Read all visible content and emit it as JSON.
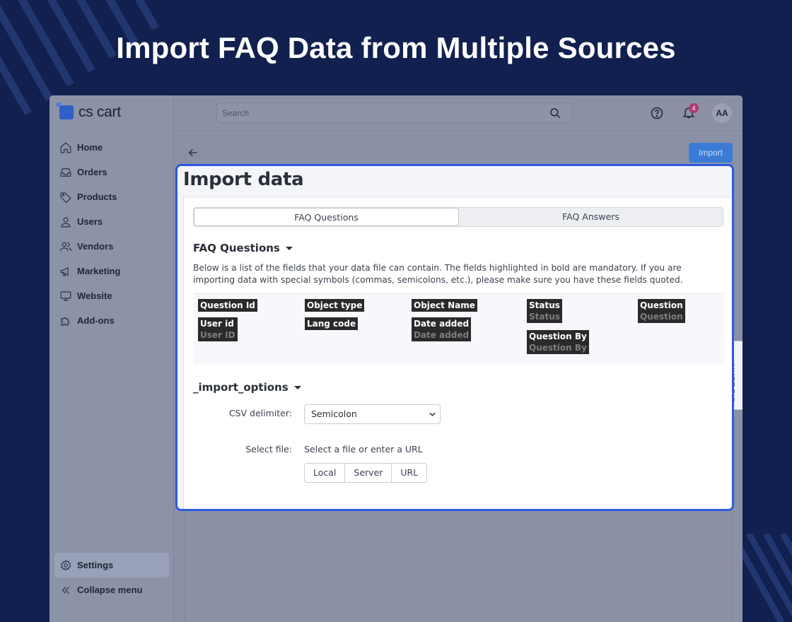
{
  "promo": {
    "title": "Import FAQ Data from Multiple Sources"
  },
  "app": {
    "logo_text": "cs cart",
    "search_placeholder": "Search",
    "notifications_count": "4",
    "avatar_initials": "AA",
    "import_button": "Import",
    "sidebar_toggle": "SIDEBAR"
  },
  "nav": {
    "items": [
      {
        "label": "Home",
        "icon": "home-icon"
      },
      {
        "label": "Orders",
        "icon": "inbox-icon"
      },
      {
        "label": "Products",
        "icon": "tag-icon"
      },
      {
        "label": "Users",
        "icon": "user-icon"
      },
      {
        "label": "Vendors",
        "icon": "users-icon"
      },
      {
        "label": "Marketing",
        "icon": "megaphone-icon"
      },
      {
        "label": "Website",
        "icon": "monitor-icon"
      },
      {
        "label": "Add-ons",
        "icon": "puzzle-icon"
      }
    ],
    "bottom": [
      {
        "label": "Settings",
        "icon": "gear-icon"
      },
      {
        "label": "Collapse menu",
        "icon": "double-chevron-left-icon"
      }
    ]
  },
  "panel": {
    "title": "Import data",
    "tabs": [
      {
        "label": "FAQ Questions"
      },
      {
        "label": "FAQ Answers"
      }
    ],
    "section_fields": "FAQ Questions",
    "description": "Below is a list of the fields that your data file can contain. The fields highlighted in bold are mandatory. If you are importing data with special symbols (commas, semicolons, etc.), please make sure you have these fields quoted.",
    "fields": [
      {
        "name": "Question Id",
        "sub": ""
      },
      {
        "name": "Object type",
        "sub": ""
      },
      {
        "name": "Object Name",
        "sub": ""
      },
      {
        "name": "Status",
        "sub": "Status"
      },
      {
        "name": "Question",
        "sub": "Question"
      },
      {
        "name": "User id",
        "sub": "User ID"
      },
      {
        "name": "Lang code",
        "sub": ""
      },
      {
        "name": "Date added",
        "sub": "Date added"
      },
      {
        "name": "Question By",
        "sub": "Question By"
      }
    ],
    "section_options": "_import_options",
    "csv_label": "CSV delimiter:",
    "csv_value": "Semicolon",
    "file_label": "Select file:",
    "file_hint": "Select a file or enter a URL",
    "file_buttons": [
      {
        "label": "Local"
      },
      {
        "label": "Server"
      },
      {
        "label": "URL"
      }
    ]
  },
  "colors": {
    "accent": "#2c5ae0",
    "background": "#11204f",
    "badge": "#b03a74"
  }
}
